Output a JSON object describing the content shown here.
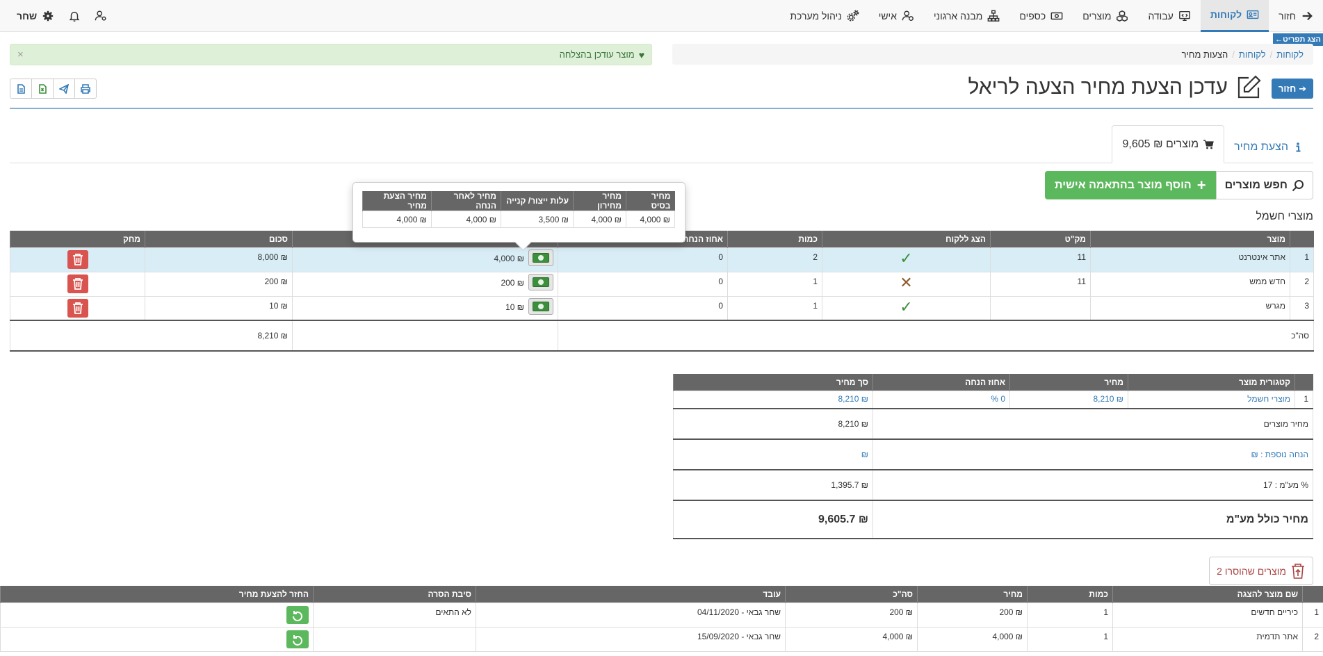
{
  "nav": {
    "back": "חזור",
    "items": [
      {
        "label": "לקוחות",
        "icon": "customers-card-icon",
        "active": true
      },
      {
        "label": "עבודה",
        "icon": "monitor-work-icon"
      },
      {
        "label": "מוצרים",
        "icon": "products-boxes-icon"
      },
      {
        "label": "כספים",
        "icon": "money-icon"
      },
      {
        "label": "מבנה ארגוני",
        "icon": "org-chart-icon"
      },
      {
        "label": "אישי",
        "icon": "personal-user-icon"
      },
      {
        "label": "ניהול מערכת",
        "icon": "system-gears-icon"
      }
    ],
    "user": "שחר"
  },
  "side_tab": "הצג תפריט←",
  "breadcrumb": {
    "root": "לקוחות",
    "parent": "לקוחות",
    "current": "הצעות מחיר"
  },
  "alert": {
    "text": "מוצר עודכן בהצלחה",
    "close": "×"
  },
  "page": {
    "back_label": "חזור",
    "title": "עדכן הצעת מחיר הצעה לריאל"
  },
  "tabs": {
    "quote": "הצעת מחיר",
    "products": "מוצרים ₪ 9,605"
  },
  "buttons": {
    "search": "חפש מוצרים",
    "add_custom": "הוסף מוצר בהתאמה אישית"
  },
  "category": "מוצרי חשמל",
  "products_table": {
    "headers": [
      "",
      "מוצר",
      "מק\"ט",
      "הצג ללקוח",
      "כמות",
      "אחוז הנחה",
      "מחיר",
      "סכום",
      "מחק"
    ],
    "rows": [
      {
        "num": "1",
        "name": "אתר אינטרנט",
        "sku": "11",
        "show": true,
        "qty": "2",
        "discount": "0",
        "price": "₪ 4,000",
        "sum": "₪ 8,000"
      },
      {
        "num": "2",
        "name": "חדש ממש",
        "sku": "11",
        "show": false,
        "qty": "1",
        "discount": "0",
        "price": "₪ 200",
        "sum": "₪ 200"
      },
      {
        "num": "3",
        "name": "מגרש",
        "sku": "",
        "show": true,
        "qty": "1",
        "discount": "0",
        "price": "₪ 10",
        "sum": "₪ 10"
      }
    ],
    "total_label": "סה\"כ",
    "total_value": "₪ 8,210"
  },
  "popover": {
    "headers": [
      "מחיר בסיס",
      "מחיר מחירון",
      "עלות ייצור/ קנייה",
      "מחיר לאחר הנחה",
      "מחיר הצעת מחיר"
    ],
    "values": [
      "₪ 4,000",
      "₪ 4,000",
      "₪ 3,500",
      "₪ 4,000",
      "₪ 4,000"
    ]
  },
  "summary": {
    "headers": [
      "",
      "קטגורית מוצר",
      "מחיר",
      "אחוז הנחה",
      "סך מחיר"
    ],
    "row": {
      "num": "1",
      "category": "מוצרי חשמל",
      "price": "₪ 8,210",
      "discount": "0 %",
      "total": "₪ 8,210"
    },
    "products_price_label": "מחיר מוצרים",
    "products_price_value": "₪ 8,210",
    "extra_discount_label": "הנחה נוספת : ₪",
    "extra_discount_value": "₪",
    "vat_label": "% מע\"מ : 17",
    "vat_value": "₪ 1,395.7",
    "grand_label": "מחיר כולל מע\"מ",
    "grand_value": "₪ 9,605.7"
  },
  "removed_button": "מוצרים שהוסרו 2",
  "removed_table": {
    "headers": [
      "",
      "שם מוצר להצגה",
      "כמות",
      "מחיר",
      "סה\"כ",
      "עובד",
      "סיבת הסרה",
      "החזר להצעת מחיר"
    ],
    "rows": [
      {
        "num": "1",
        "name": "כיריים חדשים",
        "qty": "1",
        "price": "₪ 200",
        "total": "₪ 200",
        "worker": "שחר גבאי - 04/11/2020",
        "reason": "לא התאים"
      },
      {
        "num": "2",
        "name": "אתר תדמית",
        "qty": "1",
        "price": "₪ 4,000",
        "total": "₪ 4,000",
        "worker": "שחר גבאי - 15/09/2020",
        "reason": ""
      }
    ]
  }
}
